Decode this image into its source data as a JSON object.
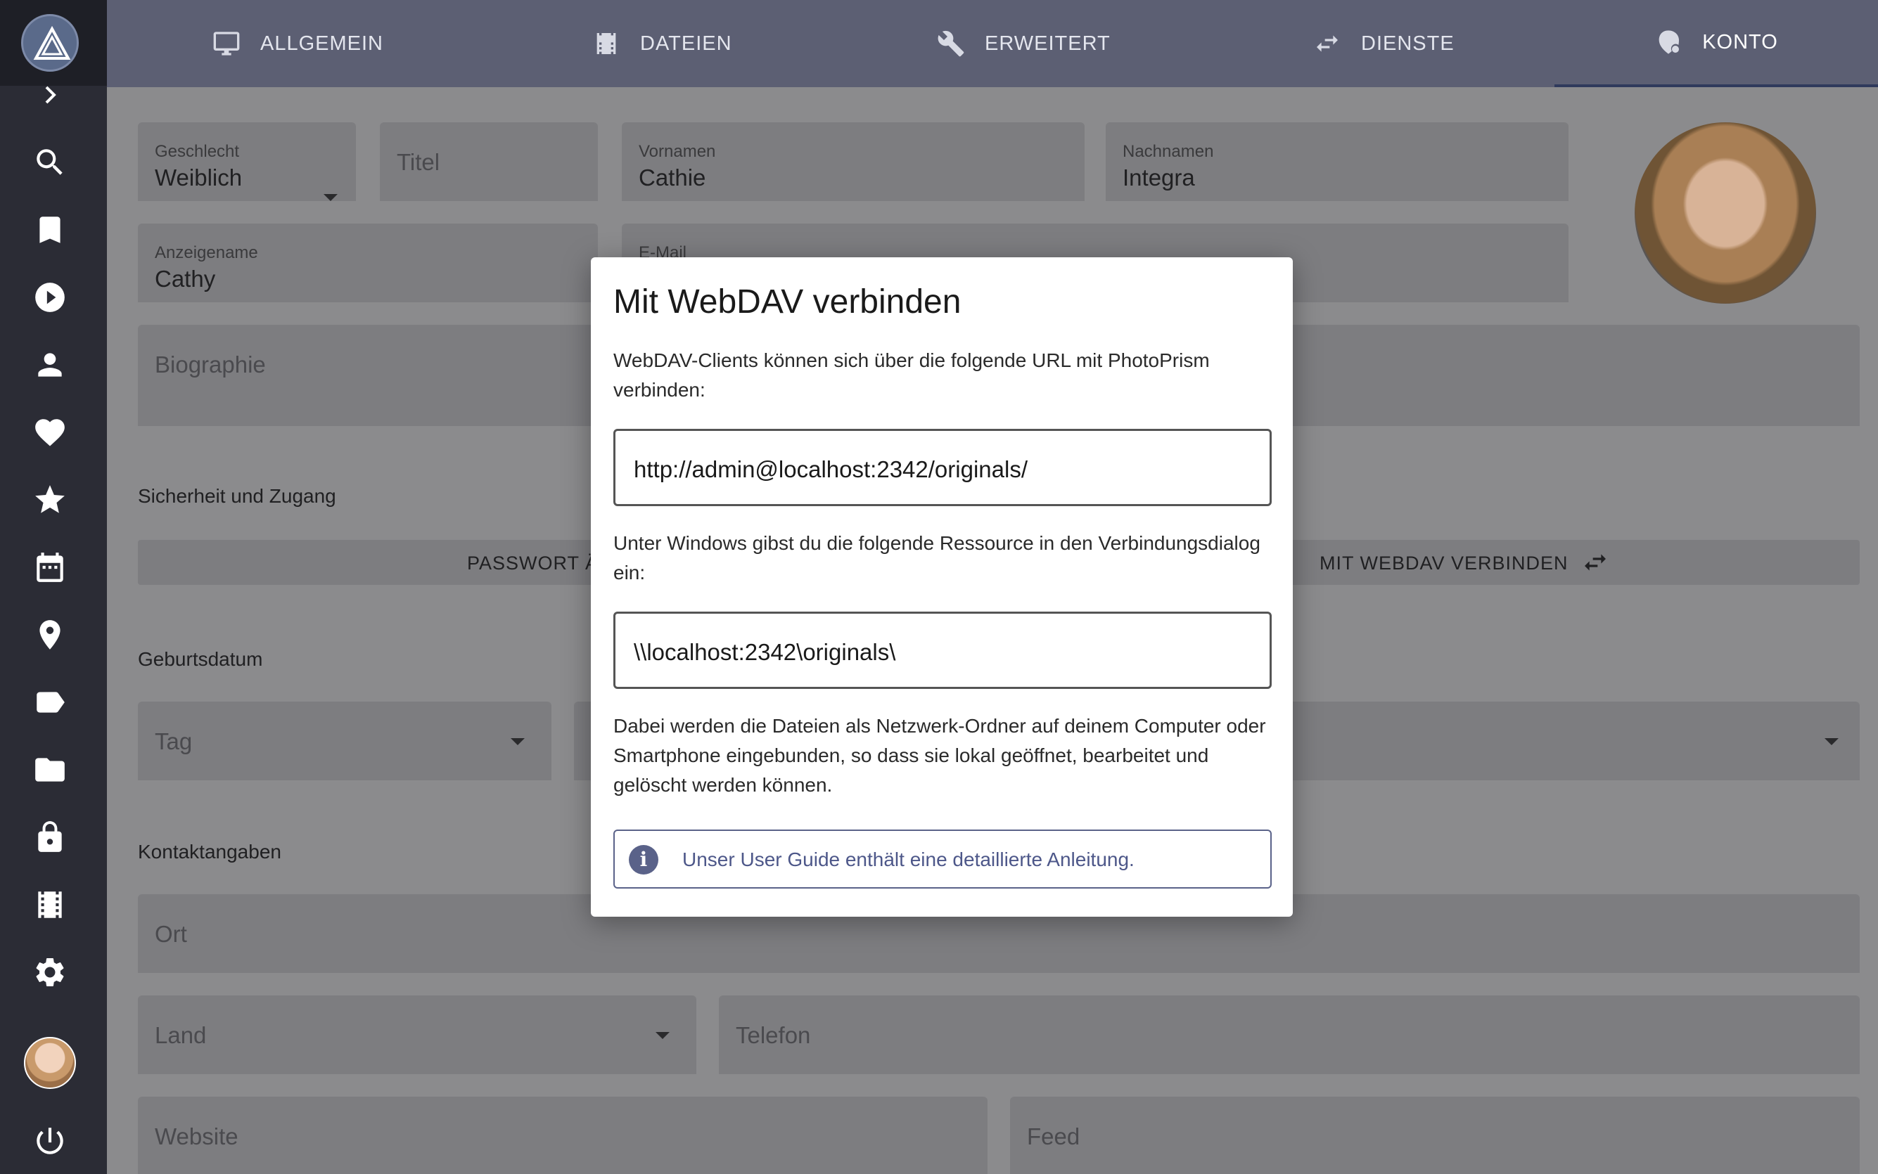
{
  "tabs": [
    {
      "label": "ALLGEMEIN",
      "icon": "monitor-icon"
    },
    {
      "label": "DATEIEN",
      "icon": "file-icon"
    },
    {
      "label": "ERWEITERT",
      "icon": "wrench-icon"
    },
    {
      "label": "DIENSTE",
      "icon": "sync-icon"
    },
    {
      "label": "KONTO",
      "icon": "account-icon"
    }
  ],
  "sidebar": {
    "icons": [
      "search-icon",
      "bookmark-icon",
      "play-icon",
      "person-icon",
      "heart-icon",
      "star-icon",
      "calendar-icon",
      "location-icon",
      "label-icon",
      "folder-icon",
      "lock-icon",
      "film-icon",
      "settings-icon",
      "power-icon"
    ]
  },
  "form": {
    "gender": {
      "label": "Geschlecht",
      "value": "Weiblich"
    },
    "title": {
      "placeholder": "Titel"
    },
    "firstname": {
      "label": "Vornamen",
      "value": "Cathie"
    },
    "lastname": {
      "label": "Nachnamen",
      "value": "Integra"
    },
    "displayname": {
      "label": "Anzeigename",
      "value": "Cathy"
    },
    "email": {
      "label": "E-Mail"
    },
    "bio": {
      "placeholder": "Biographie"
    },
    "security_heading": "Sicherheit und Zugang",
    "password_button": "PASSWORT ÄND",
    "webdav_button": "MIT WEBDAV VERBINDEN",
    "birthday_heading": "Geburtsdatum",
    "day": {
      "placeholder": "Tag"
    },
    "contact_heading": "Kontaktangaben",
    "city": {
      "placeholder": "Ort"
    },
    "country": {
      "placeholder": "Land"
    },
    "phone": {
      "placeholder": "Telefon"
    },
    "website": {
      "placeholder": "Website"
    },
    "feed": {
      "placeholder": "Feed"
    }
  },
  "dialog": {
    "title": "Mit WebDAV verbinden",
    "intro": "WebDAV-Clients können sich über die folgende URL mit PhotoPrism verbinden:",
    "url": "http://admin@localhost:2342/originals/",
    "windows_text": "Unter Windows gibst du die folgende Ressource in den Verbindungsdialog ein:",
    "unc_path": "\\\\localhost:2342\\originals\\",
    "explanation": "Dabei werden die Dateien als Netzwerk-Ordner auf deinem Computer oder Smartphone eingebunden, so dass sie lokal geöffnet, bearbeitet und gelöscht werden können.",
    "info": "Unser User Guide enthält eine detaillierte Anleitung."
  }
}
